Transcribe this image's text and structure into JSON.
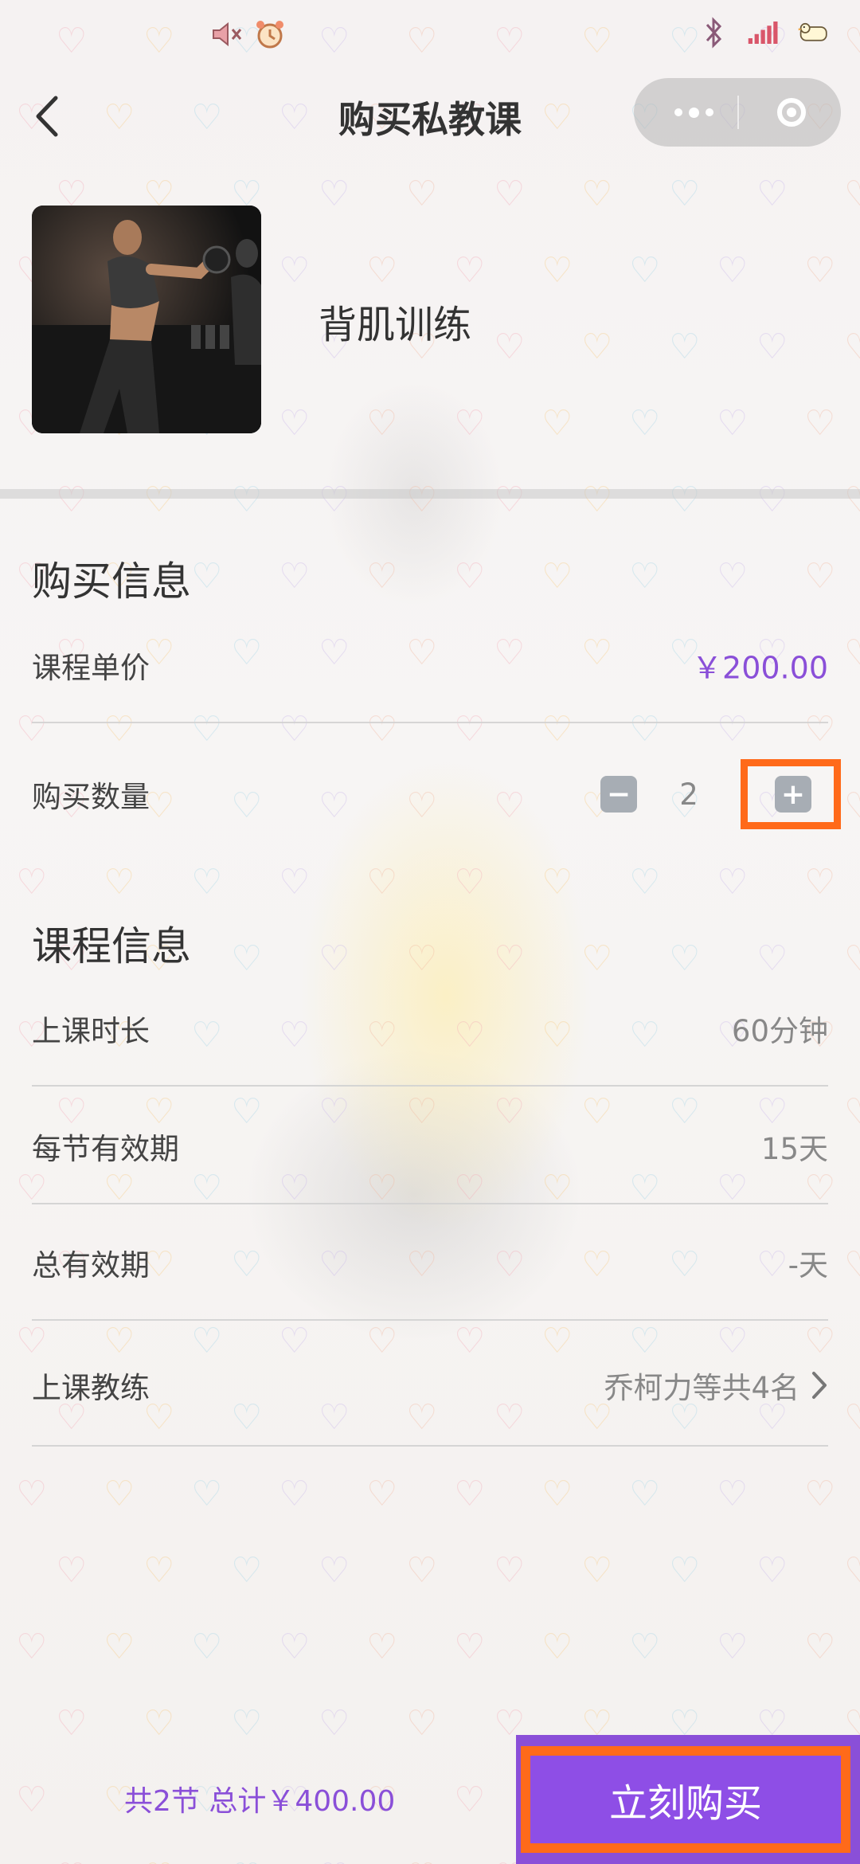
{
  "nav": {
    "title": "购买私教课"
  },
  "course": {
    "name": "背肌训练"
  },
  "purchase_info": {
    "title": "购买信息",
    "unit_price_label": "课程单价",
    "unit_price_value": "￥200.00",
    "quantity_label": "购买数量",
    "quantity_value": "2",
    "minus_symbol": "−",
    "plus_symbol": "+"
  },
  "course_info": {
    "title": "课程信息",
    "rows": [
      {
        "label": "上课时长",
        "value": "60分钟"
      },
      {
        "label": "每节有效期",
        "value": "15天"
      },
      {
        "label": "总有效期",
        "value": "-天"
      },
      {
        "label": "上课教练",
        "value": "乔柯力等共4名"
      }
    ]
  },
  "bottom": {
    "summary": "共2节 总计￥400.00",
    "buy_label": "立刻购买"
  },
  "colors": {
    "accent": "#8a4fd8",
    "highlight": "#ff6a1a"
  }
}
